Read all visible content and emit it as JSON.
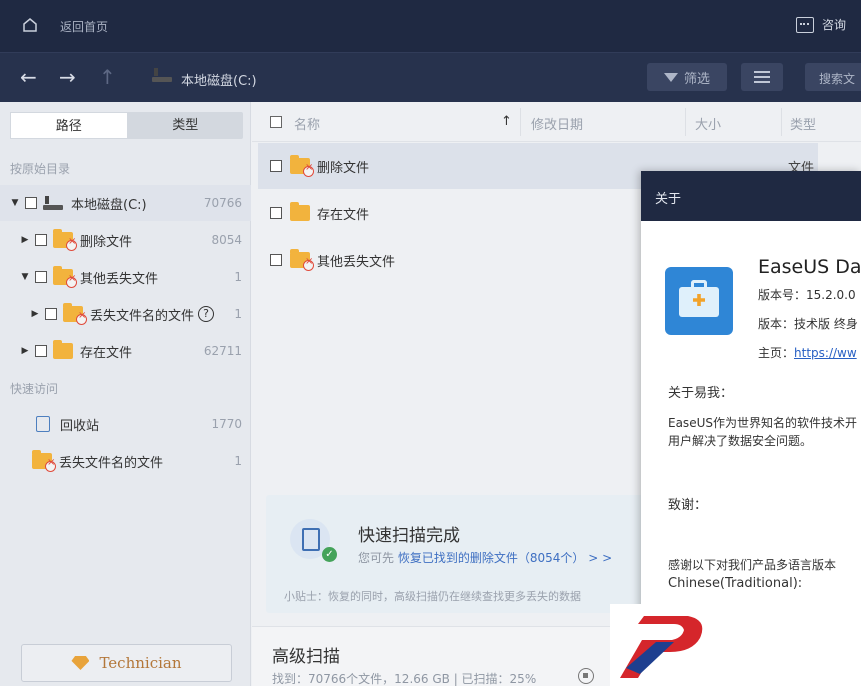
{
  "topbar": {
    "back_home": "返回首页",
    "consult": "咨询"
  },
  "nav": {
    "breadcrumb": "本地磁盘(C:)",
    "filter_label": "筛选",
    "search_placeholder": "搜索文"
  },
  "sidebar": {
    "tabs": [
      {
        "label": "路径"
      },
      {
        "label": "类型"
      }
    ],
    "section_original": "按原始目录",
    "tree": [
      {
        "label": "本地磁盘(C:)",
        "count": "70766"
      },
      {
        "label": "删除文件",
        "count": "8054"
      },
      {
        "label": "其他丢失文件",
        "count": "1"
      },
      {
        "label": "丢失文件名的文件",
        "count": "1",
        "help": "?"
      },
      {
        "label": "存在文件",
        "count": "62711"
      }
    ],
    "section_quick": "快速访问",
    "quick": [
      {
        "label": "回收站",
        "count": "1770"
      },
      {
        "label": "丢失文件名的文件",
        "count": "1"
      }
    ],
    "technician_label": "Technician"
  },
  "table": {
    "headers": {
      "name": "名称",
      "sort": "↑",
      "modified": "修改日期",
      "size": "大小",
      "type": "类型"
    },
    "rows": [
      {
        "name": "删除文件",
        "type": "文件"
      },
      {
        "name": "存在文件"
      },
      {
        "name": "其他丢失文件"
      }
    ]
  },
  "scan_card": {
    "title": "快速扫描完成",
    "sub_prefix": "您可先",
    "sub_link": "恢复已找到的删除文件（8054个）",
    "sub_suffix": " > >",
    "tip": "小贴士：恢复的同时，高级扫描仍在继续查找更多丢失的数据"
  },
  "advanced": {
    "title": "高级扫描",
    "stats": "找到：70766个文件，12.66 GB | 已扫描：25%"
  },
  "about": {
    "title": "关于",
    "app_name": "EaseUS Dat",
    "version_label": "版本号：15.2.0.0",
    "edition_label": "版本：技术版 终身",
    "homepage_label": "主页：",
    "homepage_link": "https://ww",
    "about_label": "关于易我：",
    "about_text_1": "EaseUS作为世界知名的软件技术开",
    "about_text_2": "用户解决了数据安全问题。",
    "thanks_label": "致谢：",
    "thanks_text": "感谢以下对我们产品多语言版本",
    "lang_line": "Chinese(Traditional):"
  },
  "colors": {
    "header_bg": "#1f2942",
    "nav_bg": "#27324d",
    "accent_link": "#3e6fc2",
    "folder": "#f2b33d"
  }
}
